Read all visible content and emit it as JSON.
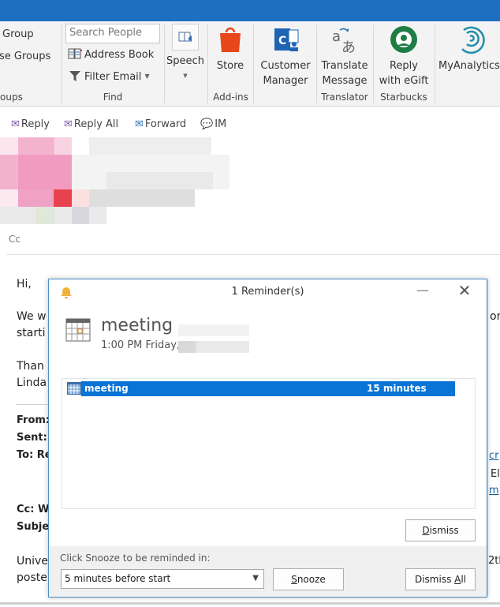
{
  "window": {
    "title_bar_color": "#1e6fc2"
  },
  "ribbon": {
    "groups_partial": {
      "items": [
        "Group",
        "se Groups"
      ],
      "label": "oups"
    },
    "find": {
      "search_placeholder": "Search People",
      "address_book": "Address Book",
      "filter_email": "Filter Email",
      "label": "Find"
    },
    "speech": {
      "label": "Speech"
    },
    "addins": {
      "store": "Store",
      "label": "Add-ins"
    },
    "customer_manager": {
      "line1": "Customer",
      "line2": "Manager"
    },
    "translator": {
      "line1": "Translate",
      "line2": "Message",
      "label": "Translator"
    },
    "starbucks": {
      "line1": "Reply",
      "line2": "with eGift",
      "label": "Starbucks"
    },
    "myanalytics": {
      "label": "MyAnalytics"
    }
  },
  "message_actions": {
    "reply": "Reply",
    "reply_all": "Reply All",
    "forward": "Forward",
    "im": "IM"
  },
  "message": {
    "cc_label": "Cc",
    "greeting": "Hi,",
    "line1_start": "We w",
    "line1_end": "on",
    "line2_start": "starti",
    "thanks": "Than",
    "signature": "Linda",
    "from_label": "From:",
    "sent_label": "Sent:",
    "to_label": "To: Re",
    "to_right_link1": "cr",
    "to_right_text": "El",
    "to_right_link2": "m",
    "cc2_label": "Cc: W",
    "subject_label": "Subje",
    "para_start1": "Unive",
    "para_start2": "poste",
    "para_end": "2th"
  },
  "reminder": {
    "title": "1 Reminder(s)",
    "subject": "meeting",
    "time": "1:00 PM Friday,",
    "items": [
      {
        "subject": "meeting",
        "due_in": "15 minutes",
        "selected": true
      }
    ],
    "dismiss_label": "Dismiss",
    "dismiss_mnemonic": "D",
    "snooze_prompt": "Click Snooze to be reminded in:",
    "snooze_selected": "5 minutes before start",
    "snooze_label": "Snooze",
    "snooze_mnemonic": "S",
    "dismiss_all_label": "Dismiss All",
    "highlight_color": "#0a74d6"
  }
}
